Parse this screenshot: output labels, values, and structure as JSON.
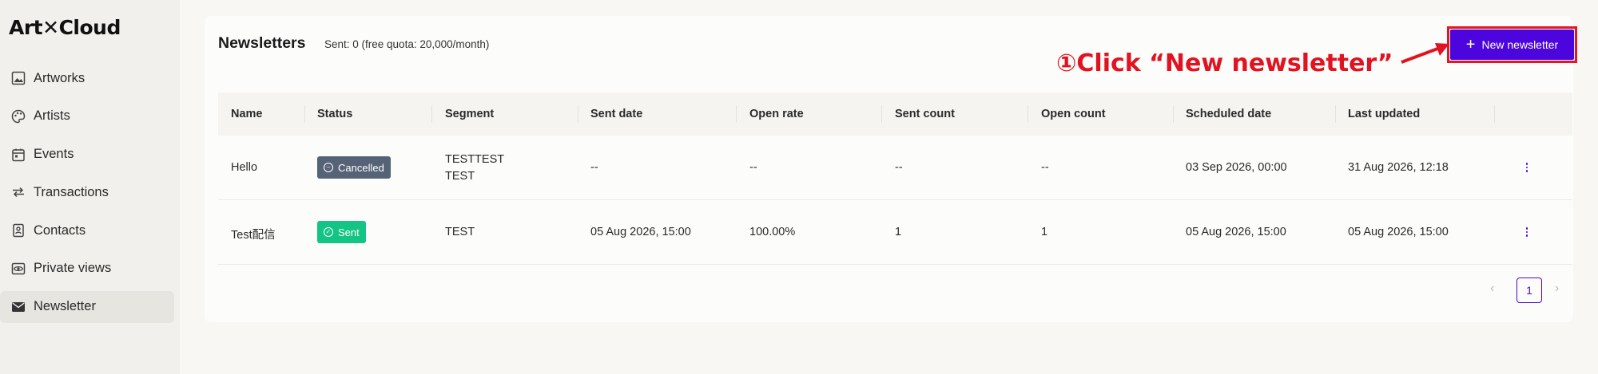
{
  "app": {
    "logo_text": "Art✕Cloud"
  },
  "sidebar": {
    "items": [
      {
        "label": "Artworks",
        "icon": "image-icon"
      },
      {
        "label": "Artists",
        "icon": "palette-icon"
      },
      {
        "label": "Events",
        "icon": "calendar-icon"
      },
      {
        "label": "Transactions",
        "icon": "swap-icon"
      },
      {
        "label": "Contacts",
        "icon": "contact-icon"
      },
      {
        "label": "Private views",
        "icon": "eye-icon"
      },
      {
        "label": "Newsletter",
        "icon": "mail-icon",
        "active": true
      }
    ]
  },
  "page": {
    "title": "Newsletters",
    "quota": "Sent: 0 (free quota: 20,000/month)",
    "new_button_label": "New newsletter",
    "annotation": "①Click “New newsletter”"
  },
  "table": {
    "columns": [
      "Name",
      "Status",
      "Segment",
      "Sent date",
      "Open rate",
      "Sent count",
      "Open count",
      "Scheduled date",
      "Last updated"
    ],
    "rows": [
      {
        "name": "Hello",
        "status": "Cancelled",
        "segment": [
          "TESTTEST",
          "TEST"
        ],
        "sent_date": "--",
        "open_rate": "--",
        "sent_count": "--",
        "open_count": "--",
        "scheduled_date": "03 Sep 2026, 00:00",
        "last_updated": "31 Aug 2026, 12:18"
      },
      {
        "name": "Test配信",
        "status": "Sent",
        "segment": [
          "TEST"
        ],
        "sent_date": "05 Aug 2026, 15:00",
        "open_rate": "100.00%",
        "sent_count": "1",
        "open_count": "1",
        "scheduled_date": "05 Aug 2026, 15:00",
        "last_updated": "05 Aug 2026, 15:00"
      }
    ]
  },
  "pagination": {
    "current_page": "1",
    "prev_icon": "chevron-left-icon",
    "next_icon": "chevron-right-icon"
  },
  "colors": {
    "accent": "#4c06dd",
    "annotation": "#e11320",
    "cancelled": "#566276",
    "sent": "#14c484"
  }
}
